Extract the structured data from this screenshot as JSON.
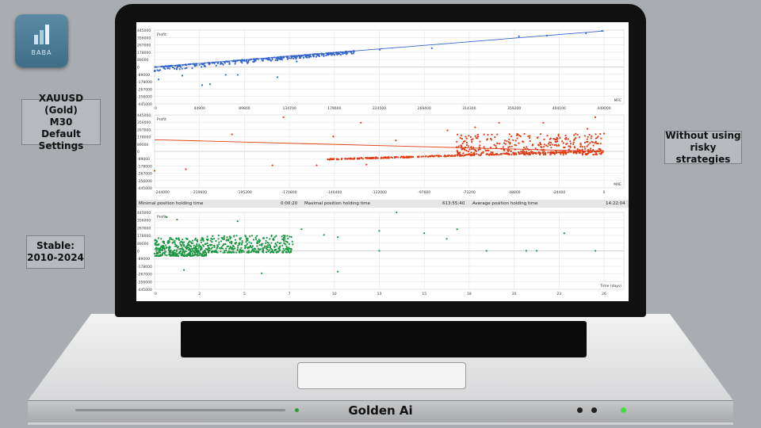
{
  "logo": {
    "text": "BABA"
  },
  "left_boxes": {
    "instrument": "XAUUSD (Gold)",
    "timeframe": "M30",
    "settings": "Default Settings",
    "stable_label": "Stable:",
    "stable_years": "2010-2024"
  },
  "right_box": {
    "line1": "Without using",
    "line2": "risky strategies"
  },
  "footer": {
    "title": "Golden Ai"
  },
  "colors": {
    "mfe": "#3366cc",
    "mae": "#e03c14",
    "time": "#1a9641",
    "background": "#a9acb1"
  },
  "stats": {
    "min_label": "Minimal position holding time",
    "min_value": "0:00:20",
    "max_label": "Maximal position holding time",
    "max_value": "613:55:40",
    "avg_label": "Average position holding time",
    "avg_value": "14:22:04"
  },
  "chart_data": [
    {
      "type": "scatter",
      "ylabel": "Profit",
      "xlabel": "MFE",
      "grid": true,
      "yticks": [
        "445000",
        "356000",
        "267000",
        "178000",
        "89000",
        "0",
        "-89000",
        "-178000",
        "-267000",
        "-356000",
        "-445000"
      ],
      "xticks": [
        "0",
        "44900",
        "89800",
        "134700",
        "179600",
        "224500",
        "269400",
        "314300",
        "359200",
        "404100",
        "449000"
      ],
      "xlim": [
        0,
        449000
      ],
      "ylim": [
        -445000,
        445000
      ],
      "trend": [
        [
          0,
          0
        ],
        [
          449000,
          435000
        ]
      ],
      "dense_regions": [
        {
          "x": [
            0,
            200000
          ],
          "y_offset_below_trend": [
            -60000,
            0
          ]
        }
      ],
      "points": [
        [
          4000,
          -151000
        ],
        [
          27700,
          -104000
        ],
        [
          47500,
          -218000
        ],
        [
          55400,
          -208000
        ],
        [
          71000,
          -95000
        ],
        [
          83000,
          -95000
        ],
        [
          122700,
          -123000
        ],
        [
          142000,
          66000
        ],
        [
          186000,
          180000
        ],
        [
          225000,
          208000
        ],
        [
          277000,
          227000
        ],
        [
          364000,
          370000
        ],
        [
          392000,
          378000
        ],
        [
          431000,
          407000
        ],
        [
          447000,
          436000
        ]
      ]
    },
    {
      "type": "scatter",
      "ylabel": "Profit",
      "xlabel": "MAE",
      "grid": true,
      "yticks": [
        "445000",
        "356000",
        "267000",
        "178000",
        "89000",
        "0",
        "-89000",
        "-178000",
        "-267000",
        "-356000",
        "-445000"
      ],
      "xticks": [
        "-244000",
        "-219600",
        "-195200",
        "-170800",
        "-146400",
        "-122000",
        "-97600",
        "-73200",
        "-48800",
        "-24400",
        "0"
      ],
      "xlim": [
        -244000,
        0
      ],
      "ylim": [
        -445000,
        445000
      ],
      "trend": [
        [
          -244000,
          142000
        ],
        [
          0,
          0
        ]
      ],
      "dense_regions": [
        {
          "x": [
            -80000,
            0
          ],
          "y": [
            -40000,
            220000
          ]
        },
        {
          "x": [
            -150000,
            0
          ],
          "y_lower_band": [
            -104000,
            -5000
          ]
        }
      ],
      "points": [
        [
          -244000,
          -237000
        ],
        [
          -227000,
          -218000
        ],
        [
          -202000,
          208000
        ],
        [
          -180000,
          -170000
        ],
        [
          -174000,
          417000
        ],
        [
          -156000,
          -170000
        ],
        [
          -147000,
          180000
        ],
        [
          -132000,
          350000
        ],
        [
          -129000,
          -161000
        ],
        [
          -113000,
          133000
        ],
        [
          -85000,
          256000
        ],
        [
          -70000,
          294000
        ],
        [
          -57000,
          350000
        ],
        [
          -33000,
          350000
        ],
        [
          -9000,
          275000
        ],
        [
          -4700,
          417000
        ]
      ]
    },
    {
      "type": "scatter",
      "ylabel": "Profit",
      "xlabel": "Time (days)",
      "grid": true,
      "yticks": [
        "445000",
        "356000",
        "267000",
        "178000",
        "89000",
        "0",
        "-89000",
        "-178000",
        "-267000",
        "-356000",
        "-445000"
      ],
      "xticks": [
        "0",
        "2",
        "5",
        "7",
        "10",
        "13",
        "15",
        "18",
        "20",
        "23",
        "26"
      ],
      "xlim": [
        0,
        26
      ],
      "ylim": [
        -445000,
        445000
      ],
      "dense_regions": [
        {
          "x": [
            0,
            3
          ],
          "y": [
            -60000,
            150000
          ]
        },
        {
          "x": [
            3,
            8
          ],
          "y": [
            -20000,
            180000
          ]
        }
      ],
      "points": [
        [
          0.7,
          390000
        ],
        [
          1.3,
          362000
        ],
        [
          1.7,
          -222000
        ],
        [
          4.8,
          343000
        ],
        [
          6.2,
          -260000
        ],
        [
          8.5,
          250000
        ],
        [
          9.8,
          185000
        ],
        [
          10.6,
          158000
        ],
        [
          10.6,
          -241000
        ],
        [
          13,
          232000
        ],
        [
          13,
          0
        ],
        [
          14,
          445000
        ],
        [
          15.6,
          204000
        ],
        [
          16.9,
          139000
        ],
        [
          17.5,
          250000
        ],
        [
          19.2,
          0
        ],
        [
          21.5,
          0
        ],
        [
          22.1,
          0
        ],
        [
          23.7,
          204000
        ],
        [
          25.5,
          0
        ]
      ]
    }
  ]
}
